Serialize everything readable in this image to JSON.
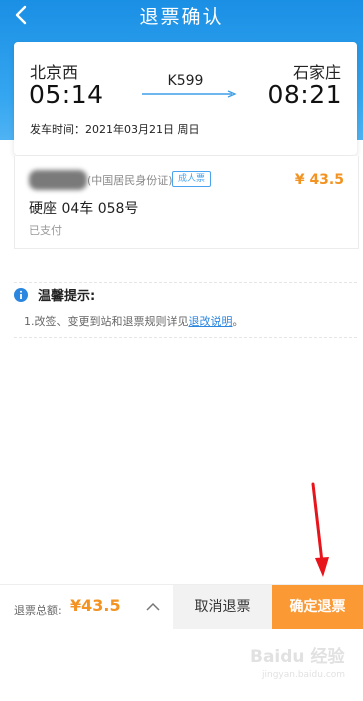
{
  "header": {
    "title": "退票确认",
    "back_icon": "chevron-left-icon"
  },
  "trip": {
    "from_station": "北京西",
    "to_station": "石家庄",
    "depart_time": "05:14",
    "arrive_time": "08:21",
    "train_no": "K599",
    "depart_date_label": "发车时间：",
    "depart_date": "2021年03月21日 周日"
  },
  "passenger": {
    "id_type": "(中国居民身份证)",
    "ticket_type": "成人票",
    "price": "¥ 43.5",
    "seat": "硬座 04车 058号",
    "status": "已支付"
  },
  "tips": {
    "title": "温馨提示:",
    "text_prefix": "1.改签、变更到站和退票规则详见",
    "link_text": "退改说明",
    "text_suffix": "。"
  },
  "bottom": {
    "total_label": "退票总额:",
    "total_value": "¥43.5",
    "cancel_label": "取消退票",
    "confirm_label": "确定退票"
  },
  "watermark": {
    "text": "Baidu 经验",
    "sub": "jingyan.baidu.com"
  },
  "colors": {
    "header_blue": "#1a8fe4",
    "accent_orange": "#f29322",
    "confirm_orange": "#fb9a34",
    "link_blue": "#2b86df",
    "annotation_red": "#e8141b"
  }
}
